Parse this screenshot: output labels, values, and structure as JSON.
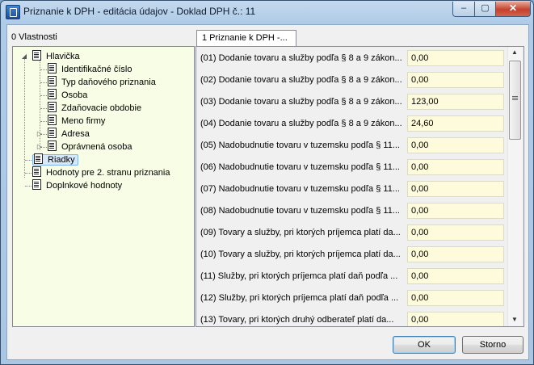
{
  "window": {
    "title": "Priznanie k DPH - editácia údajov - Doklad DPH č.: 11",
    "controls": {
      "minimize": "–",
      "maximize": "▢",
      "close": "✕"
    }
  },
  "left_panel": {
    "label": "0 Vlastnosti",
    "tree": [
      {
        "label": "Hlavička",
        "level": 0,
        "expander": "◢"
      },
      {
        "label": "Identifikačné číslo",
        "level": 1,
        "expander": ""
      },
      {
        "label": "Typ daňového priznania",
        "level": 1,
        "expander": ""
      },
      {
        "label": "Osoba",
        "level": 1,
        "expander": ""
      },
      {
        "label": "Zdaňovacie obdobie",
        "level": 1,
        "expander": ""
      },
      {
        "label": "Meno firmy",
        "level": 1,
        "expander": ""
      },
      {
        "label": "Adresa",
        "level": 1,
        "expander": "▷"
      },
      {
        "label": "Oprávnená osoba",
        "level": 1,
        "expander": "▷"
      },
      {
        "label": "Riadky",
        "level": 0,
        "expander": "",
        "selected": true
      },
      {
        "label": "Hodnoty pre 2. stranu priznania",
        "level": 0,
        "expander": ""
      },
      {
        "label": "Doplnkové hodnoty",
        "level": 0,
        "expander": ""
      }
    ]
  },
  "right_panel": {
    "tab_label": "1 Priznanie k DPH -...",
    "rows": [
      {
        "label": "(01) Dodanie tovaru a služby podľa § 8 a 9 zákon...",
        "value": "0,00"
      },
      {
        "label": "(02) Dodanie tovaru a služby podľa § 8 a 9 zákon...",
        "value": "0,00"
      },
      {
        "label": "(03) Dodanie tovaru a služby podľa § 8 a 9 zákon...",
        "value": "123,00"
      },
      {
        "label": "(04) Dodanie tovaru a služby podľa § 8 a 9 zákon...",
        "value": "24,60"
      },
      {
        "label": "(05) Nadobudnutie tovaru v tuzemsku podľa § 11...",
        "value": "0,00"
      },
      {
        "label": "(06) Nadobudnutie tovaru v tuzemsku podľa § 11...",
        "value": "0,00"
      },
      {
        "label": "(07) Nadobudnutie tovaru v tuzemsku podľa § 11...",
        "value": "0,00"
      },
      {
        "label": "(08) Nadobudnutie tovaru v tuzemsku podľa § 11...",
        "value": "0,00"
      },
      {
        "label": "(09) Tovary a služby, pri ktorých príjemca platí da...",
        "value": "0,00"
      },
      {
        "label": "(10) Tovary a služby, pri ktorých príjemca platí da...",
        "value": "0,00"
      },
      {
        "label": "(11) Služby, pri ktorých príjemca platí daň podľa ...",
        "value": "0,00"
      },
      {
        "label": "(12) Služby, pri ktorých príjemca platí daň podľa ...",
        "value": "0,00"
      },
      {
        "label": "(13) Tovary, pri ktorých druhý odberateľ platí da...",
        "value": "0,00"
      }
    ]
  },
  "buttons": {
    "ok": "OK",
    "cancel": "Storno"
  }
}
